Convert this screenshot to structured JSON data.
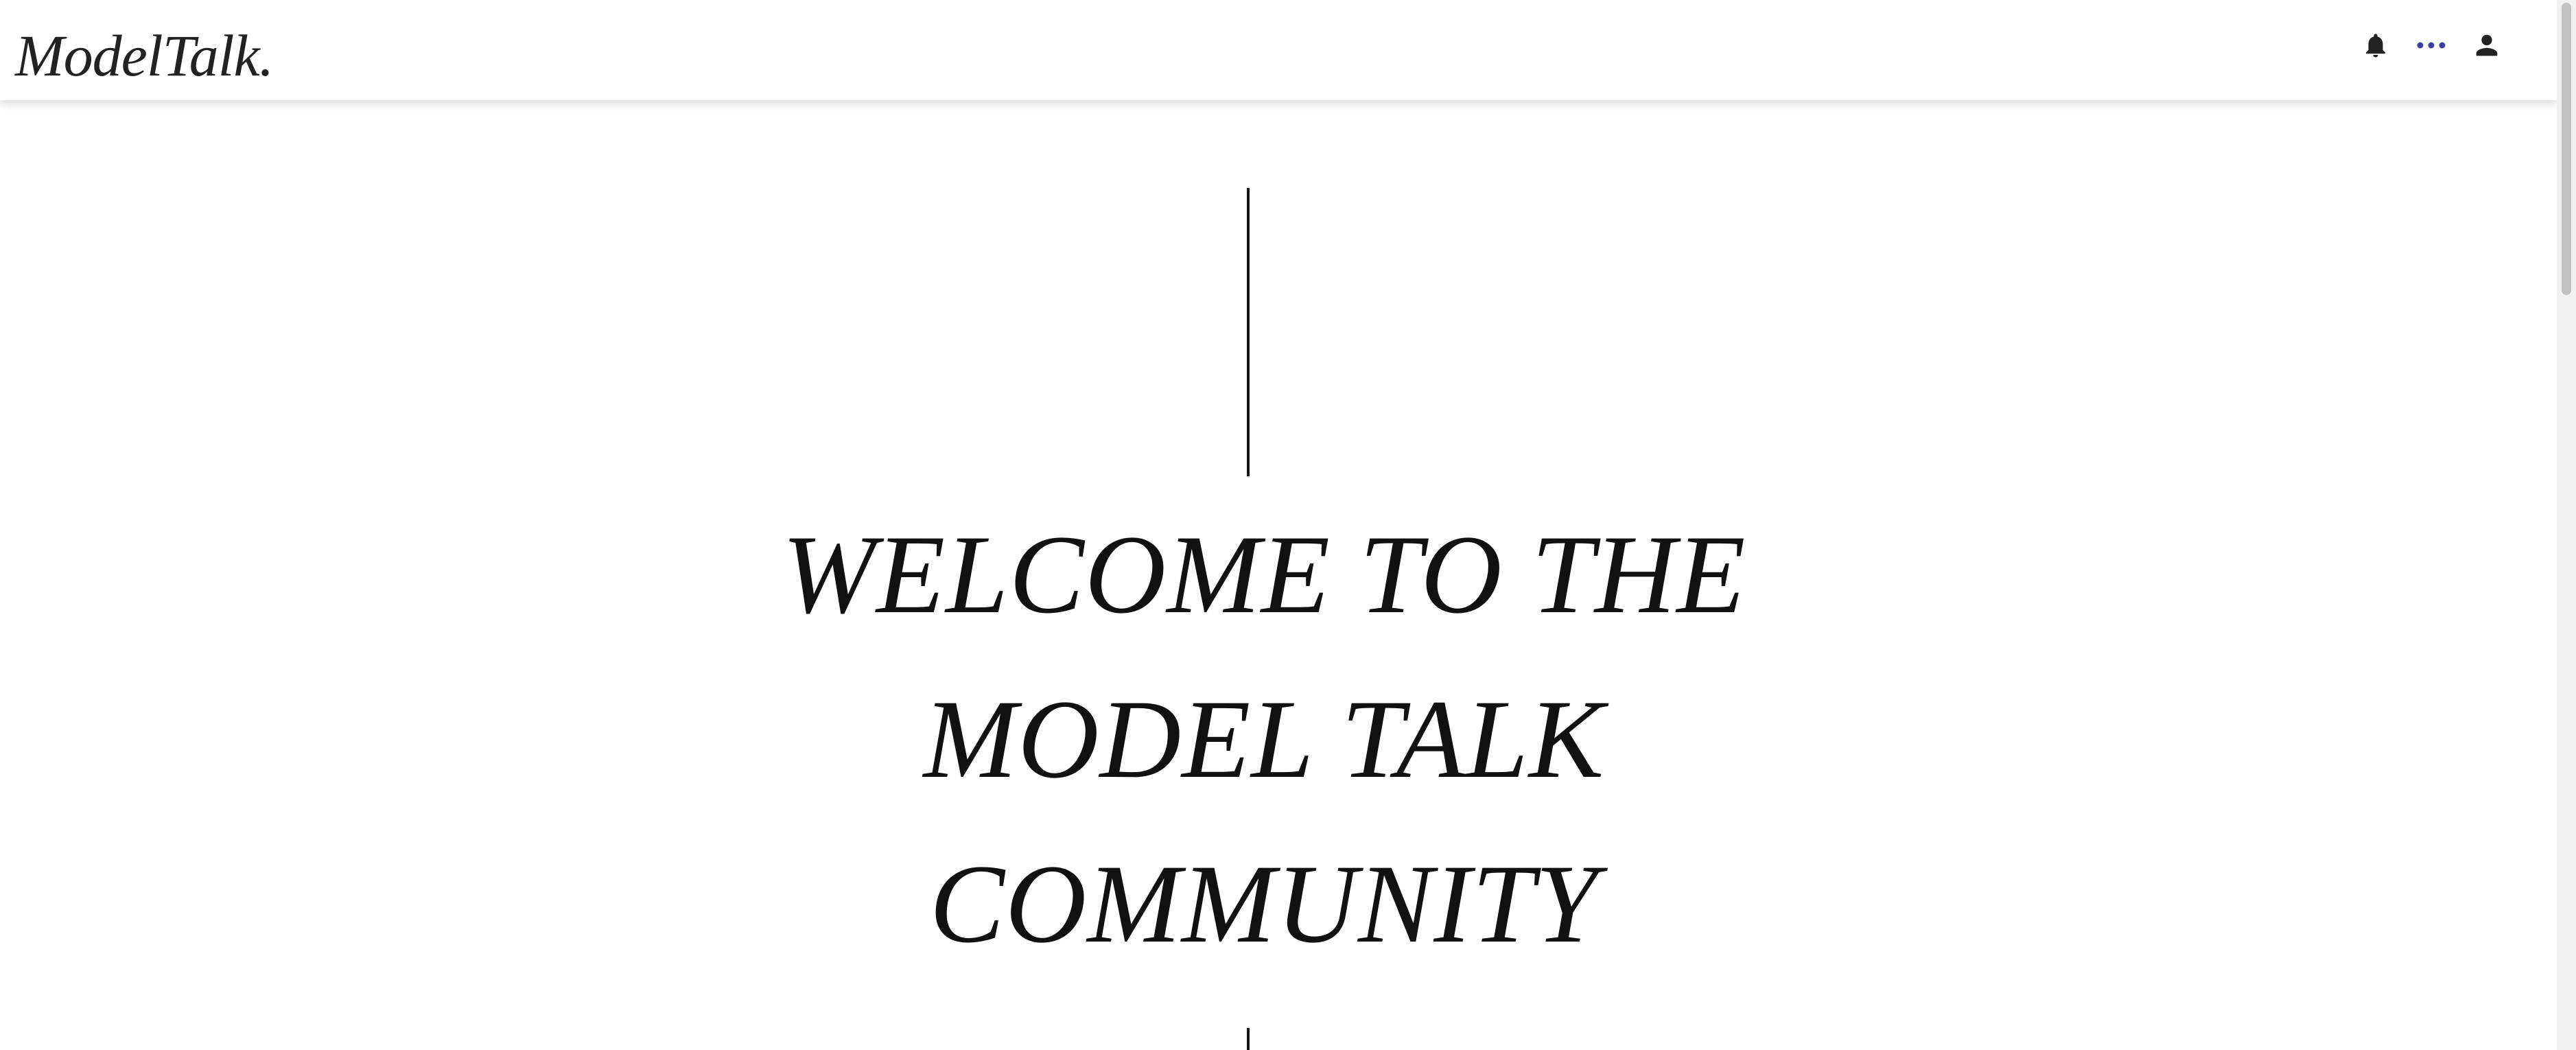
{
  "header": {
    "logo": "ModelTalk.",
    "icons": [
      {
        "name": "bell-icon",
        "color": "#222222"
      },
      {
        "name": "more-icon",
        "color": "#3f3f9f"
      },
      {
        "name": "user-icon",
        "color": "#222222"
      }
    ]
  },
  "hero": {
    "title_lines": [
      "WELCOME TO THE",
      "MODEL TALK",
      "COMMUNITY"
    ]
  },
  "colors": {
    "background": "#ffffff",
    "text": "#111111",
    "accent": "#3f3f9f"
  }
}
